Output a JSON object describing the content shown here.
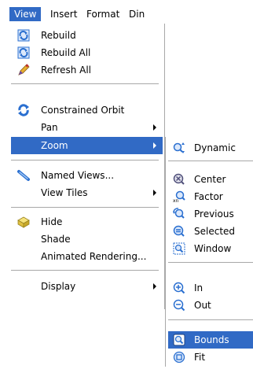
{
  "menubar": {
    "items": [
      {
        "label": "View",
        "active": true
      },
      {
        "label": "Insert"
      },
      {
        "label": "Format"
      },
      {
        "label": "Din"
      }
    ]
  },
  "view_menu": {
    "items": [
      {
        "label": "Rebuild",
        "icon": "rebuild-icon"
      },
      {
        "label": "Rebuild All",
        "icon": "rebuild-all-icon"
      },
      {
        "label": "Refresh All",
        "icon": "refresh-all-icon"
      },
      {
        "label": "Constrained Orbit",
        "icon": "constrained-orbit-icon"
      },
      {
        "label": "Pan",
        "submenu": true
      },
      {
        "label": "Zoom",
        "submenu": true,
        "highlighted": true
      },
      {
        "label": "Named Views...",
        "icon": "named-views-icon"
      },
      {
        "label": "View Tiles",
        "submenu": true
      },
      {
        "label": "Hide",
        "icon": "hide-icon"
      },
      {
        "label": "Shade"
      },
      {
        "label": "Animated Rendering..."
      },
      {
        "label": "Display",
        "submenu": true
      }
    ]
  },
  "zoom_submenu": {
    "items": [
      {
        "label": "Dynamic",
        "icon": "zoom-dynamic-icon"
      },
      {
        "label": "Center",
        "icon": "zoom-center-icon"
      },
      {
        "label": "Factor",
        "icon": "zoom-factor-icon"
      },
      {
        "label": "Previous",
        "icon": "zoom-previous-icon"
      },
      {
        "label": "Selected",
        "icon": "zoom-selected-icon"
      },
      {
        "label": "Window",
        "icon": "zoom-window-icon"
      },
      {
        "label": "In",
        "icon": "zoom-in-icon"
      },
      {
        "label": "Out",
        "icon": "zoom-out-icon"
      },
      {
        "label": "Bounds",
        "icon": "zoom-bounds-icon",
        "highlighted": true
      },
      {
        "label": "Fit",
        "icon": "zoom-fit-icon"
      }
    ]
  },
  "colors": {
    "highlight": "#316ac5",
    "separator": "#a8a8a8",
    "icon_blue": "#2a6fd0"
  }
}
